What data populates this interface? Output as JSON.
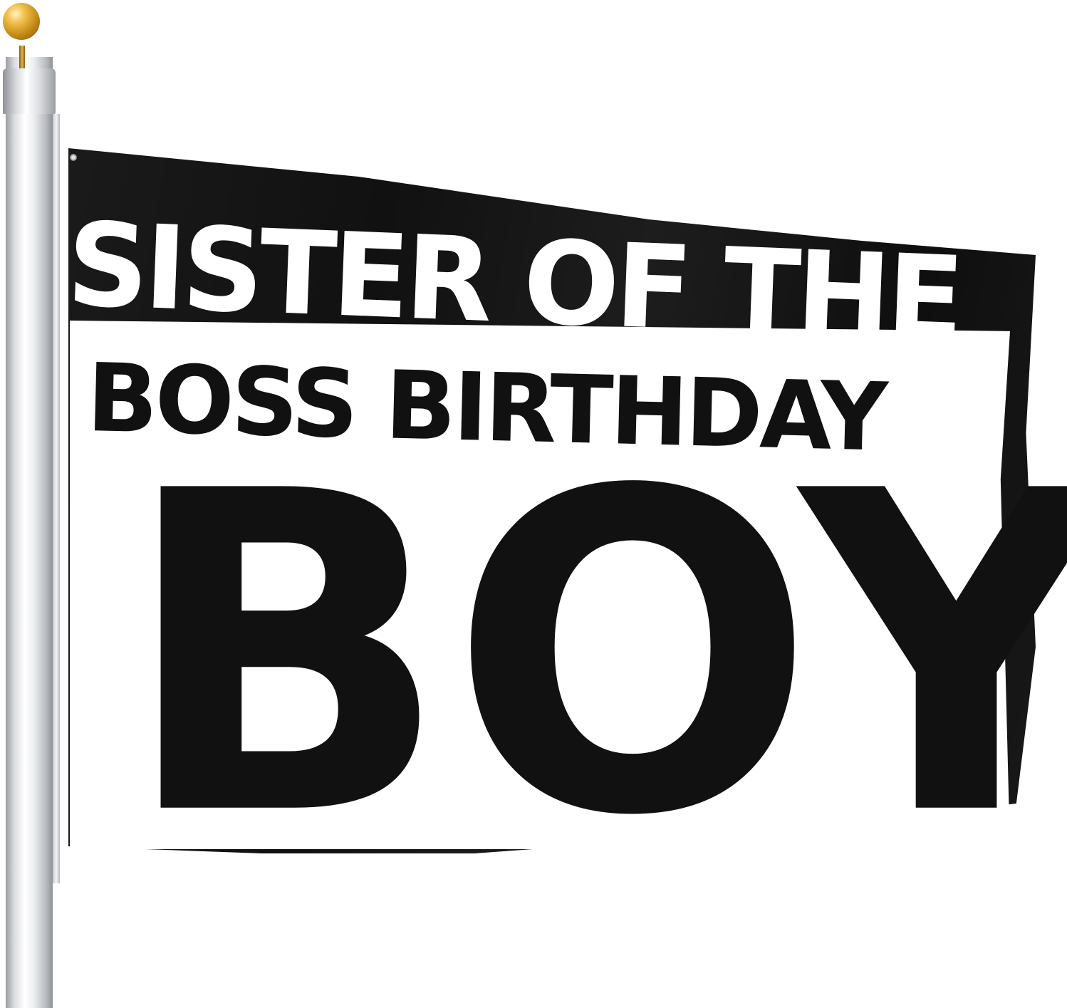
{
  "flag": {
    "line1": "SISTER OF THE",
    "line2": "BOSS BIRTHDAY",
    "line3": "BOY",
    "colors": {
      "flag_background": "#111111",
      "lettering_light": "#ffffff",
      "lettering_dark": "#111111",
      "finial": "#d9a52c",
      "pole": "#d9dbde"
    }
  },
  "icons": {
    "finial": "gold-ball-icon",
    "grommet": "grommet-icon"
  }
}
